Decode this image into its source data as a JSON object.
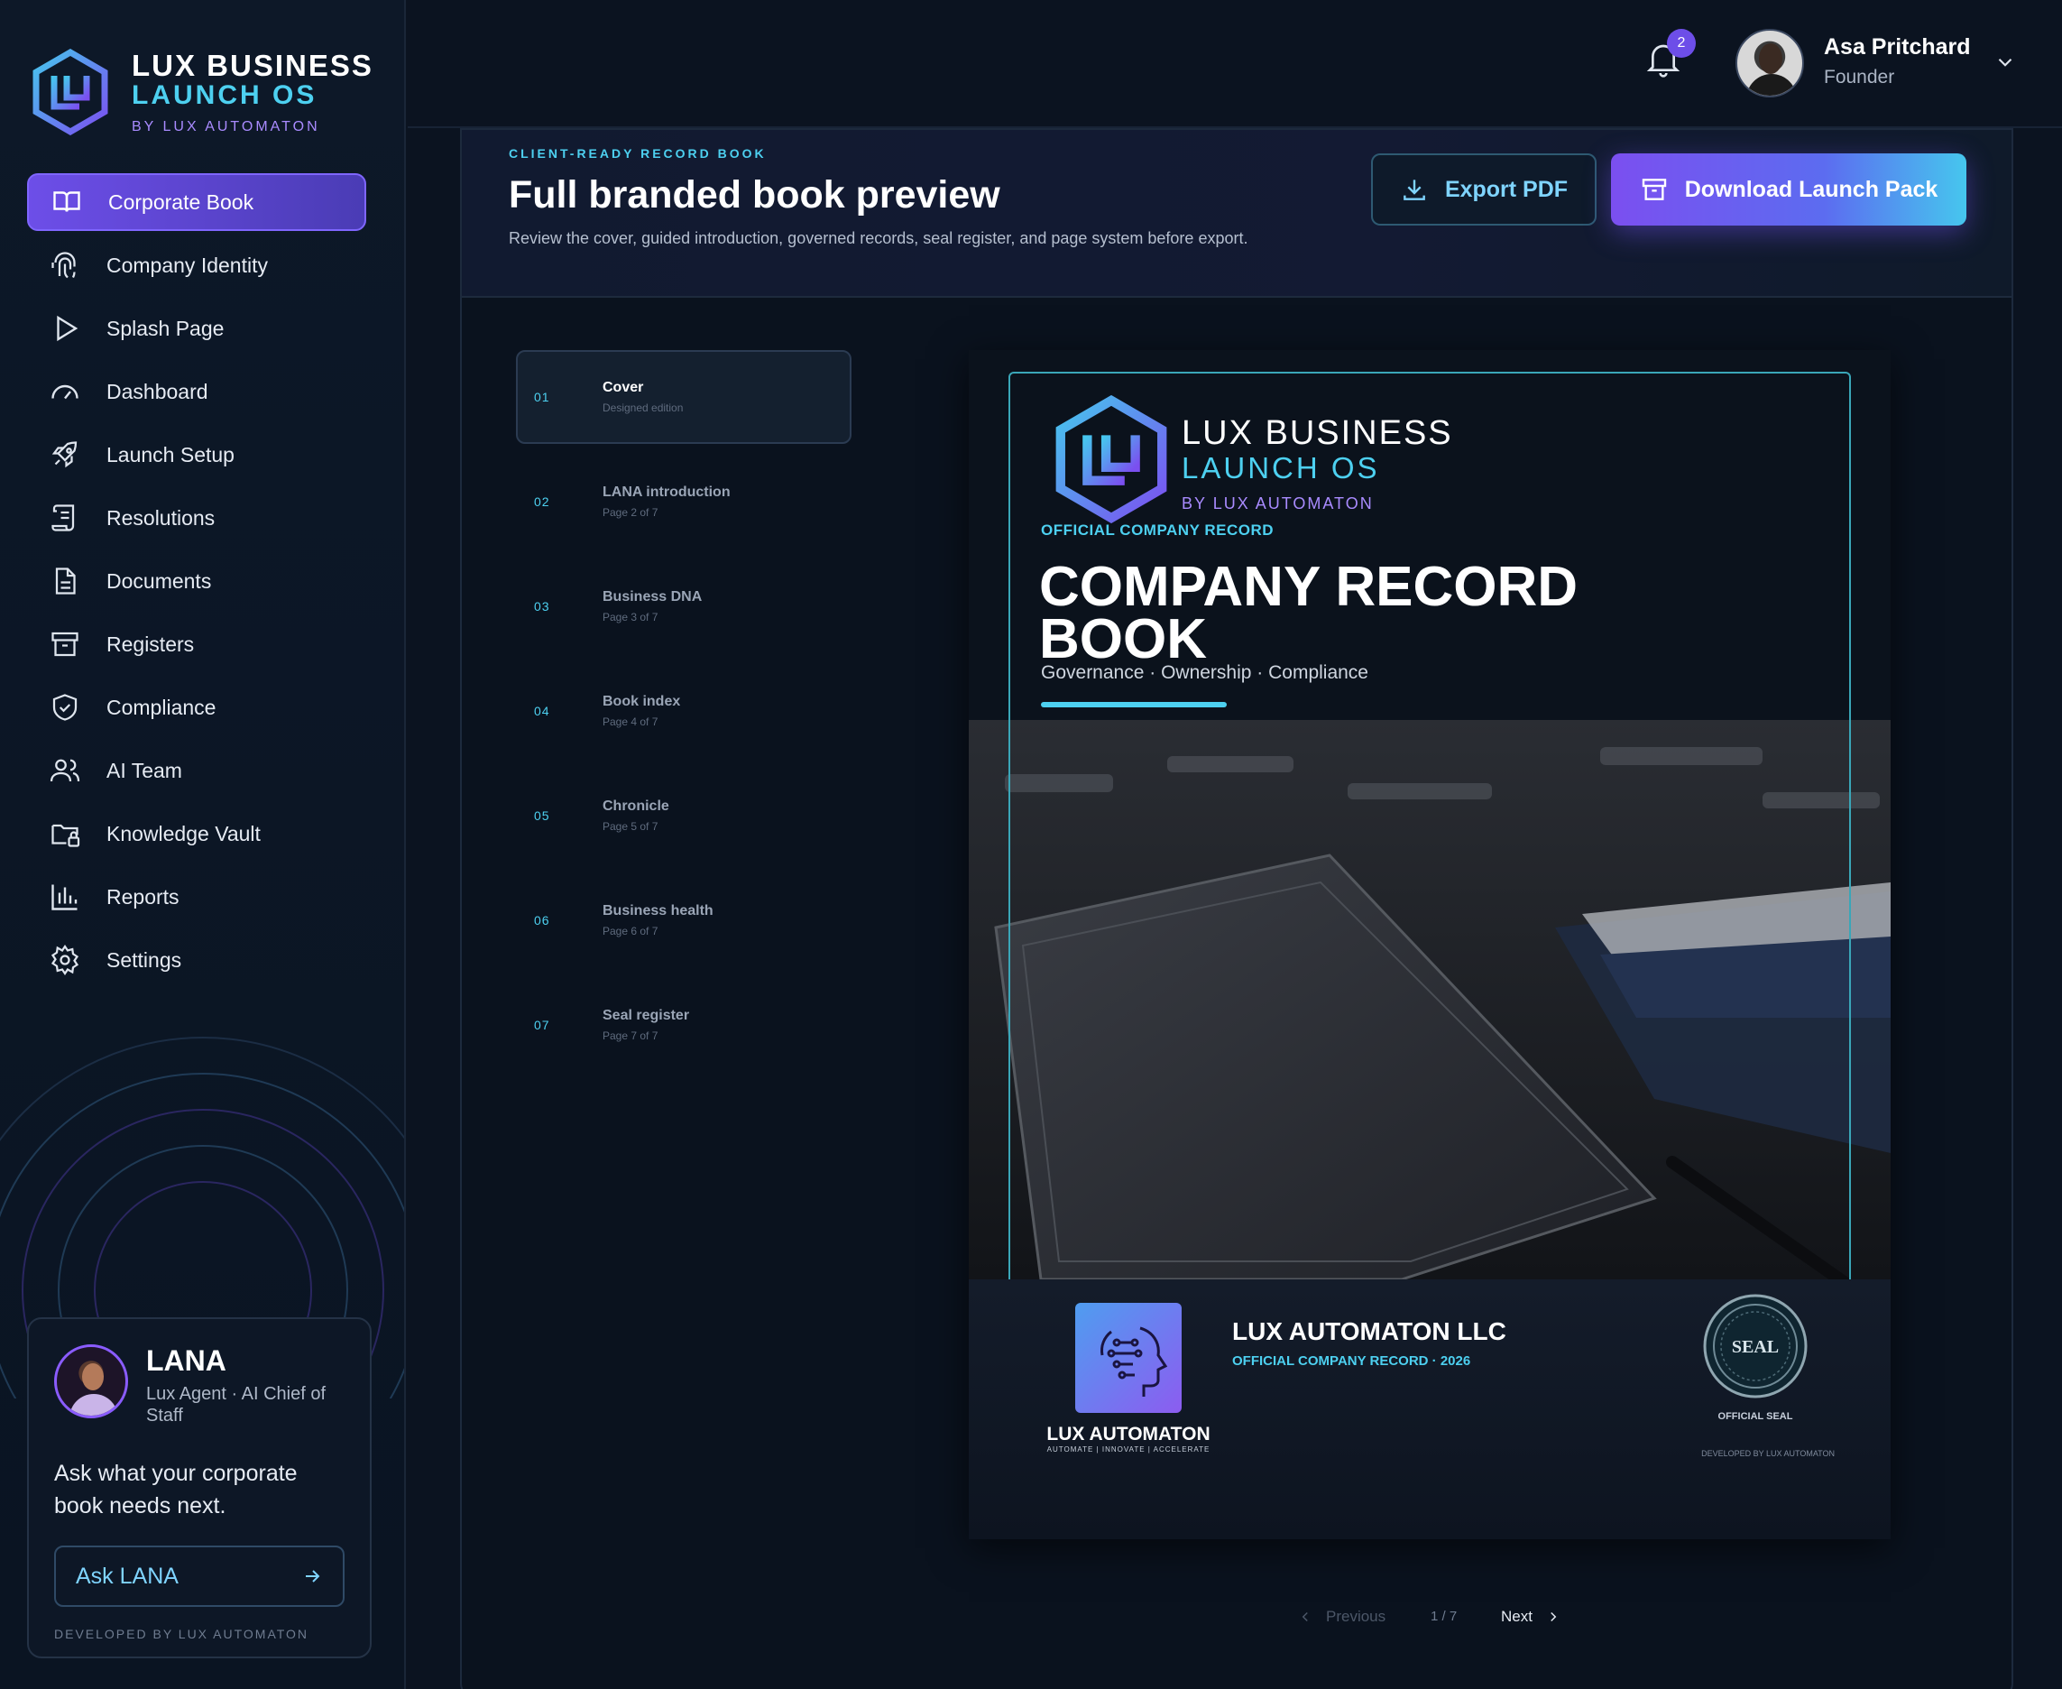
{
  "brand": {
    "line1": "LUX BUSINESS",
    "line2": "LAUNCH OS",
    "line3": "BY LUX AUTOMATON"
  },
  "sidebar": {
    "items": [
      {
        "label": "Corporate Book",
        "icon": "book-icon",
        "active": true
      },
      {
        "label": "Company Identity",
        "icon": "fingerprint-icon"
      },
      {
        "label": "Splash Page",
        "icon": "play-icon"
      },
      {
        "label": "Dashboard",
        "icon": "gauge-icon"
      },
      {
        "label": "Launch Setup",
        "icon": "rocket-icon"
      },
      {
        "label": "Resolutions",
        "icon": "scroll-icon"
      },
      {
        "label": "Documents",
        "icon": "document-icon"
      },
      {
        "label": "Registers",
        "icon": "archive-icon"
      },
      {
        "label": "Compliance",
        "icon": "shield-check-icon"
      },
      {
        "label": "AI Team",
        "icon": "users-icon"
      },
      {
        "label": "Knowledge Vault",
        "icon": "folder-lock-icon"
      },
      {
        "label": "Reports",
        "icon": "bar-chart-icon"
      },
      {
        "label": "Settings",
        "icon": "gear-icon"
      }
    ]
  },
  "lana": {
    "name": "LANA",
    "role": "Lux Agent · AI Chief of Staff",
    "prompt": "Ask what your corporate book needs next.",
    "button": "Ask LANA",
    "developed": "DEVELOPED BY LUX AUTOMATON"
  },
  "topbar": {
    "notifications": "2",
    "user_name": "Asa Pritchard",
    "user_role": "Founder"
  },
  "panel": {
    "eyebrow": "CLIENT-READY RECORD BOOK",
    "title": "Full branded book preview",
    "subtitle": "Review the cover, guided introduction, governed records, seal register, and page system before export.",
    "export_label": "Export PDF",
    "download_label": "Download Launch Pack"
  },
  "toc": [
    {
      "num": "01",
      "title": "Cover",
      "sub": "Designed edition",
      "active": true
    },
    {
      "num": "02",
      "title": "LANA introduction",
      "sub": "Page 2 of 7"
    },
    {
      "num": "03",
      "title": "Business DNA",
      "sub": "Page 3 of 7"
    },
    {
      "num": "04",
      "title": "Book index",
      "sub": "Page 4 of 7"
    },
    {
      "num": "05",
      "title": "Chronicle",
      "sub": "Page 5 of 7"
    },
    {
      "num": "06",
      "title": "Business health",
      "sub": "Page 6 of 7"
    },
    {
      "num": "07",
      "title": "Seal register",
      "sub": "Page 7 of 7"
    }
  ],
  "book": {
    "brand1": "LUX BUSINESS",
    "brand2": "LAUNCH OS",
    "brand3": "BY LUX AUTOMATON",
    "eyebrow": "OFFICIAL COMPANY RECORD",
    "title": "COMPANY RECORD BOOK",
    "tagline": "Governance · Ownership · Compliance",
    "footer_logo_name": "LUX AUTOMATON",
    "footer_logo_tag": "AUTOMATE | INNOVATE | ACCELERATE",
    "company": "LUX AUTOMATON LLC",
    "record_line": "OFFICIAL COMPANY RECORD · 2026",
    "seal_text": "SEAL",
    "seal_label": "OFFICIAL SEAL",
    "developed": "DEVELOPED BY LUX AUTOMATON"
  },
  "pager": {
    "previous": "Previous",
    "count": "1 / 7",
    "next": "Next"
  },
  "colors": {
    "accent_cyan": "#4dd0f0",
    "accent_purple": "#6d4ee8",
    "background": "#0b1320"
  }
}
